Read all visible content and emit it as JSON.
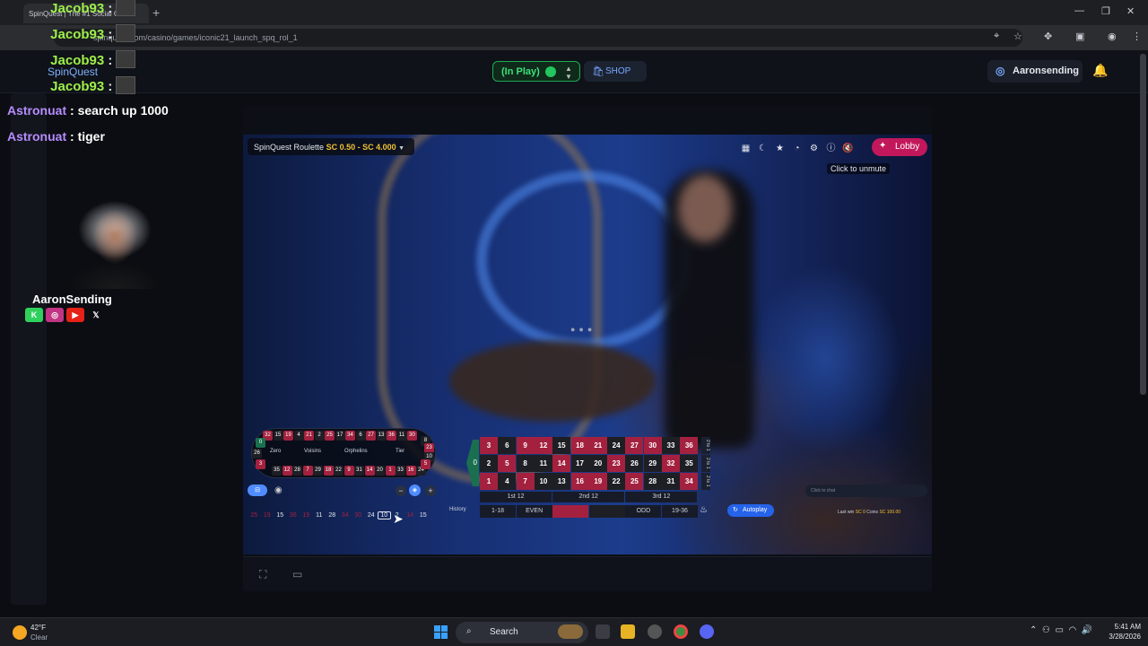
{
  "browser": {
    "tab_title": "SpinQuest | The #1 Social Casi",
    "url": "spinquest.com/casino/games/iconic21_launch_spq_rol_1"
  },
  "header": {
    "status_label": "(In Play)",
    "shop_label": "SHOP",
    "username": "Aaronsending"
  },
  "game": {
    "title": "SpinQuest Roulette",
    "bet_range": "SC 0.50 - SC 4.000",
    "lobby_label": "Lobby",
    "unmute_tooltip": "Click to unmute",
    "autoplay_label": "Autoplay",
    "history_label": "History",
    "chat_placeholder": "Click to chat",
    "last_win_label": "Last win",
    "last_win_value": "SC 0",
    "coins_label": "Coins",
    "coins_value": "SC 100.00"
  },
  "racetrack": {
    "top_row": [
      {
        "n": "32",
        "c": "#a3213f"
      },
      {
        "n": "15",
        "c": "#1d1f25"
      },
      {
        "n": "19",
        "c": "#a3213f"
      },
      {
        "n": "4",
        "c": "#1d1f25"
      },
      {
        "n": "21",
        "c": "#a3213f"
      },
      {
        "n": "2",
        "c": "#1d1f25"
      },
      {
        "n": "25",
        "c": "#a3213f"
      },
      {
        "n": "17",
        "c": "#1d1f25"
      },
      {
        "n": "34",
        "c": "#a3213f"
      },
      {
        "n": "6",
        "c": "#1d1f25"
      },
      {
        "n": "27",
        "c": "#a3213f"
      },
      {
        "n": "13",
        "c": "#1d1f25"
      },
      {
        "n": "36",
        "c": "#a3213f"
      },
      {
        "n": "11",
        "c": "#1d1f25"
      },
      {
        "n": "30",
        "c": "#a3213f"
      }
    ],
    "bottom_row": [
      {
        "n": "35",
        "c": "#1d1f25"
      },
      {
        "n": "12",
        "c": "#a3213f"
      },
      {
        "n": "28",
        "c": "#1d1f25"
      },
      {
        "n": "7",
        "c": "#a3213f"
      },
      {
        "n": "29",
        "c": "#1d1f25"
      },
      {
        "n": "18",
        "c": "#a3213f"
      },
      {
        "n": "22",
        "c": "#1d1f25"
      },
      {
        "n": "9",
        "c": "#a3213f"
      },
      {
        "n": "31",
        "c": "#1d1f25"
      },
      {
        "n": "14",
        "c": "#a3213f"
      },
      {
        "n": "20",
        "c": "#1d1f25"
      },
      {
        "n": "1",
        "c": "#a3213f"
      },
      {
        "n": "33",
        "c": "#1d1f25"
      },
      {
        "n": "16",
        "c": "#a3213f"
      },
      {
        "n": "24",
        "c": "#1d1f25"
      }
    ],
    "left_end": [
      {
        "n": "0",
        "c": "#1a6f4f"
      },
      {
        "n": "26",
        "c": "#1d1f25"
      },
      {
        "n": "3",
        "c": "#a3213f"
      }
    ],
    "right_end": [
      {
        "n": "8",
        "c": "#1d1f25"
      },
      {
        "n": "23",
        "c": "#a3213f"
      },
      {
        "n": "10",
        "c": "#1d1f25"
      },
      {
        "n": "5",
        "c": "#a3213f"
      }
    ],
    "sections": [
      "Zero",
      "Voisins",
      "Orphelins",
      "Tier"
    ]
  },
  "table": {
    "zero": "0",
    "rows": [
      [
        {
          "n": "3",
          "r": true
        },
        {
          "n": "6",
          "r": false
        },
        {
          "n": "9",
          "r": true
        },
        {
          "n": "12",
          "r": true
        },
        {
          "n": "15",
          "r": false
        },
        {
          "n": "18",
          "r": true
        },
        {
          "n": "21",
          "r": true
        },
        {
          "n": "24",
          "r": false
        },
        {
          "n": "27",
          "r": true
        },
        {
          "n": "30",
          "r": true
        },
        {
          "n": "33",
          "r": false
        },
        {
          "n": "36",
          "r": true
        }
      ],
      [
        {
          "n": "2",
          "r": false
        },
        {
          "n": "5",
          "r": true
        },
        {
          "n": "8",
          "r": false
        },
        {
          "n": "11",
          "r": false
        },
        {
          "n": "14",
          "r": true
        },
        {
          "n": "17",
          "r": false
        },
        {
          "n": "20",
          "r": false
        },
        {
          "n": "23",
          "r": true
        },
        {
          "n": "26",
          "r": false
        },
        {
          "n": "29",
          "r": false
        },
        {
          "n": "32",
          "r": true
        },
        {
          "n": "35",
          "r": false
        }
      ],
      [
        {
          "n": "1",
          "r": true
        },
        {
          "n": "4",
          "r": false
        },
        {
          "n": "7",
          "r": true
        },
        {
          "n": "10",
          "r": false
        },
        {
          "n": "13",
          "r": false
        },
        {
          "n": "16",
          "r": true
        },
        {
          "n": "19",
          "r": true
        },
        {
          "n": "22",
          "r": false
        },
        {
          "n": "25",
          "r": true
        },
        {
          "n": "28",
          "r": false
        },
        {
          "n": "31",
          "r": false
        },
        {
          "n": "34",
          "r": true
        }
      ]
    ],
    "column_bets": [
      "2 to 1",
      "2 to 1",
      "2 to 1"
    ],
    "dozens": [
      "1st 12",
      "2nd 12",
      "3rd 12"
    ],
    "outside": [
      "1-18",
      "EVEN",
      "",
      "",
      "ODD",
      "19-36"
    ],
    "colors": {
      "red": "#a3213f",
      "black": "#1d1f25",
      "green": "#1a6f4f"
    }
  },
  "history": [
    {
      "n": "25",
      "c": "#a3213f"
    },
    {
      "n": "19",
      "c": "#a3213f"
    },
    {
      "n": "15",
      "c": "#e6e8ee"
    },
    {
      "n": "36",
      "c": "#a3213f"
    },
    {
      "n": "19",
      "c": "#a3213f"
    },
    {
      "n": "11",
      "c": "#e6e8ee"
    },
    {
      "n": "28",
      "c": "#e6e8ee"
    },
    {
      "n": "34",
      "c": "#a3213f"
    },
    {
      "n": "30",
      "c": "#a3213f"
    },
    {
      "n": "24",
      "c": "#e6e8ee"
    },
    {
      "n": "10",
      "c": "#e6e8ee"
    },
    {
      "n": "2",
      "c": "#e6e8ee"
    },
    {
      "n": "14",
      "c": "#a3213f"
    },
    {
      "n": "15",
      "c": "#e6e8ee"
    }
  ],
  "stream": {
    "chat": [
      {
        "name": "Jacob93",
        "sep": ":"
      },
      {
        "name": "Jacob93",
        "sep": ":"
      },
      {
        "name": "Jacob93",
        "sep": ":"
      },
      {
        "name": "Jacob93",
        "sep": ":"
      }
    ],
    "spinquest_label": "SpinQuest",
    "messages": [
      {
        "name": "Astronuat",
        "text": ": search up 1000"
      },
      {
        "name": "Astronuat",
        "text": ": tiger"
      }
    ],
    "streamer_name": "AaronSending"
  },
  "taskbar": {
    "temp": "42°F",
    "condition": "Clear",
    "search_label": "Search",
    "time": "5:41 AM",
    "date": "3/28/2026"
  }
}
